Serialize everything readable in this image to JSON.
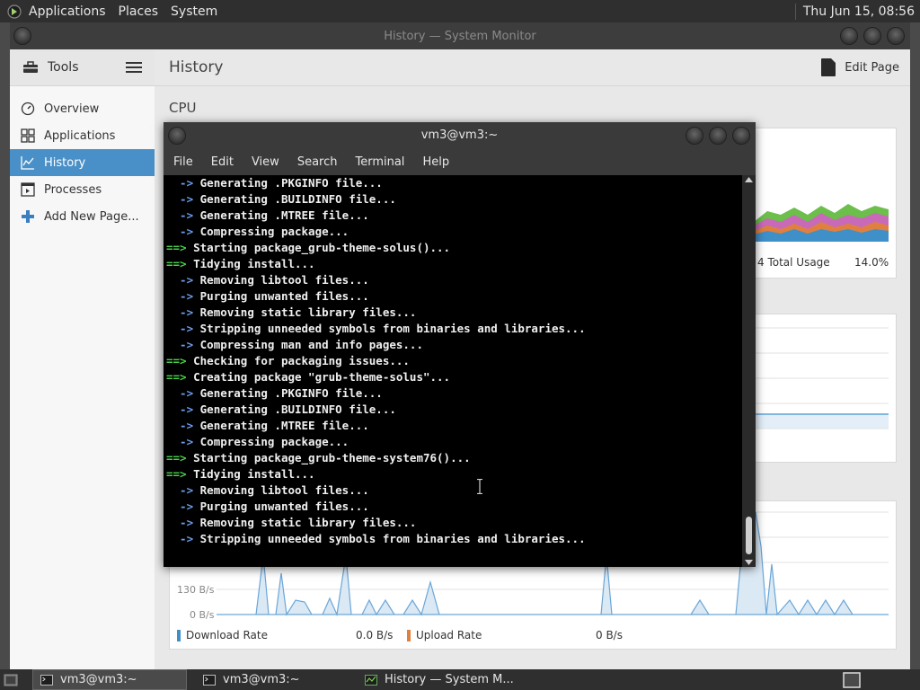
{
  "top_panel": {
    "menus": [
      "Applications",
      "Places",
      "System"
    ],
    "clock": "Thu Jun 15, 08:56"
  },
  "sysmon": {
    "window_title": "History — System Monitor",
    "sidebar": {
      "header": "Tools",
      "items": [
        {
          "label": "Overview",
          "icon": "overview-icon"
        },
        {
          "label": "Applications",
          "icon": "applications-grid-icon"
        },
        {
          "label": "History",
          "icon": "history-chart-icon",
          "active": true
        },
        {
          "label": "Processes",
          "icon": "processes-icon"
        },
        {
          "label": "Add New Page...",
          "icon": "plus-icon"
        }
      ]
    },
    "page_title": "History",
    "edit_page": "Edit Page",
    "cpu_section": "CPU",
    "cpu_total_label": "4 Total Usage",
    "cpu_total_value": "14.0%",
    "net_axis": [
      "130 B/s",
      "0 B/s"
    ],
    "download_label": "Download Rate",
    "download_value": "0.0 B/s",
    "upload_label": "Upload Rate",
    "upload_value": "0 B/s",
    "colors": {
      "download": "#3f8fc8",
      "upload": "#e08040",
      "accent": "#4a90c8"
    }
  },
  "terminal": {
    "title": "vm3@vm3:~",
    "menus": [
      "File",
      "Edit",
      "View",
      "Search",
      "Terminal",
      "Help"
    ],
    "lines": [
      {
        "p": "  -> ",
        "t": "Generating .PKGINFO file...",
        "k": "b"
      },
      {
        "p": "  -> ",
        "t": "Generating .BUILDINFO file...",
        "k": "b"
      },
      {
        "p": "  -> ",
        "t": "Generating .MTREE file...",
        "k": "b"
      },
      {
        "p": "  -> ",
        "t": "Compressing package...",
        "k": "b"
      },
      {
        "p": "==> ",
        "t": "Starting package_grub-theme-solus()...",
        "k": "g"
      },
      {
        "p": "==> ",
        "t": "Tidying install...",
        "k": "g"
      },
      {
        "p": "  -> ",
        "t": "Removing libtool files...",
        "k": "b"
      },
      {
        "p": "  -> ",
        "t": "Purging unwanted files...",
        "k": "b"
      },
      {
        "p": "  -> ",
        "t": "Removing static library files...",
        "k": "b"
      },
      {
        "p": "  -> ",
        "t": "Stripping unneeded symbols from binaries and libraries...",
        "k": "b"
      },
      {
        "p": "  -> ",
        "t": "Compressing man and info pages...",
        "k": "b"
      },
      {
        "p": "==> ",
        "t": "Checking for packaging issues...",
        "k": "g"
      },
      {
        "p": "==> ",
        "t": "Creating package \"grub-theme-solus\"...",
        "k": "g"
      },
      {
        "p": "  -> ",
        "t": "Generating .PKGINFO file...",
        "k": "b"
      },
      {
        "p": "  -> ",
        "t": "Generating .BUILDINFO file...",
        "k": "b"
      },
      {
        "p": "  -> ",
        "t": "Generating .MTREE file...",
        "k": "b"
      },
      {
        "p": "  -> ",
        "t": "Compressing package...",
        "k": "b"
      },
      {
        "p": "==> ",
        "t": "Starting package_grub-theme-system76()...",
        "k": "g"
      },
      {
        "p": "==> ",
        "t": "Tidying install...",
        "k": "g"
      },
      {
        "p": "  -> ",
        "t": "Removing libtool files...",
        "k": "b"
      },
      {
        "p": "  -> ",
        "t": "Purging unwanted files...",
        "k": "b"
      },
      {
        "p": "  -> ",
        "t": "Removing static library files...",
        "k": "b"
      },
      {
        "p": "  -> ",
        "t": "Stripping unneeded symbols from binaries and libraries...",
        "k": "b"
      }
    ]
  },
  "taskbar": {
    "tasks": [
      {
        "label": "vm3@vm3:~",
        "icon": "terminal-icon",
        "active": true
      },
      {
        "label": "vm3@vm3:~",
        "icon": "terminal-icon",
        "active": false
      },
      {
        "label": "History — System M...",
        "icon": "system-monitor-icon",
        "active": false
      }
    ]
  }
}
